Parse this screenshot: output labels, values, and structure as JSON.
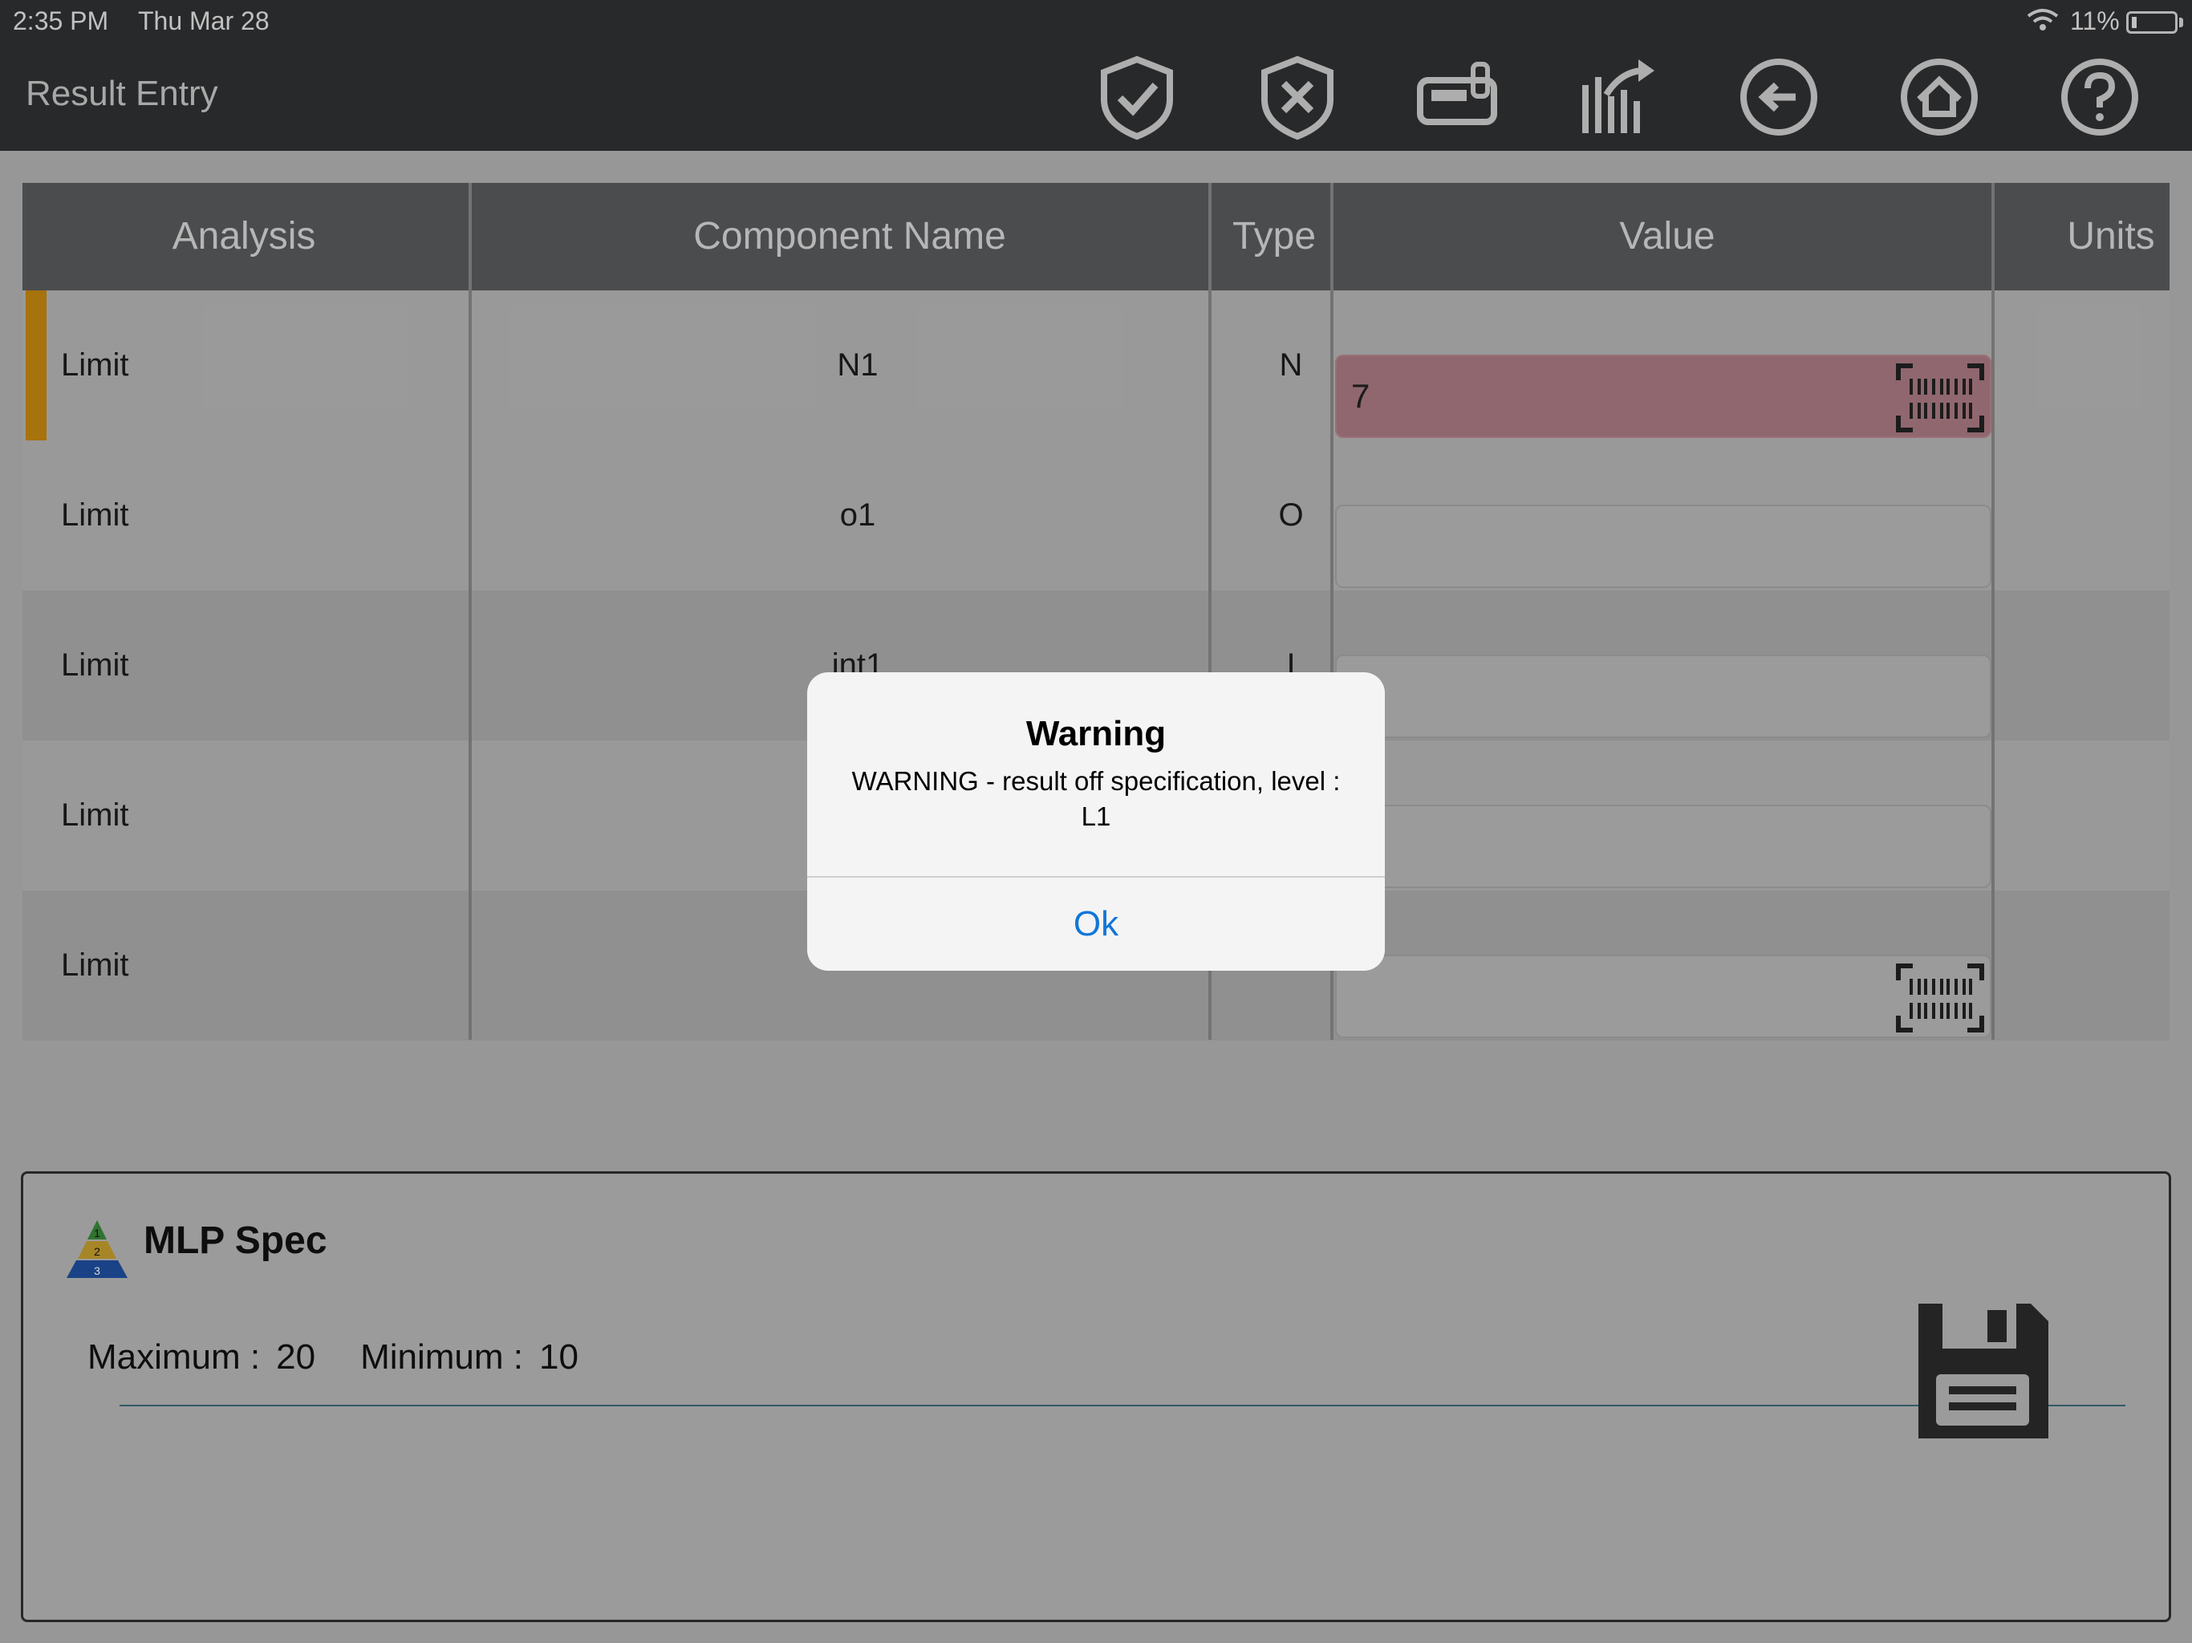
{
  "status": {
    "time": "2:35 PM",
    "date": "Thu Mar 28",
    "battery": "11%"
  },
  "nav": {
    "title": "Result Entry",
    "icons": [
      "shield-check-icon",
      "shield-x-icon",
      "instrument-icon",
      "chart-share-icon",
      "back-arrow-icon",
      "home-icon",
      "help-icon"
    ]
  },
  "table": {
    "headers": {
      "analysis": "Analysis",
      "component": "Component Name",
      "type": "Type",
      "value": "Value",
      "units": "Units"
    },
    "rows": [
      {
        "analysis": "Limit",
        "component": "N1",
        "type": "N",
        "value": "7"
      },
      {
        "analysis": "Limit",
        "component": "o1",
        "type": "O",
        "value": ""
      },
      {
        "analysis": "Limit",
        "component": "int1",
        "type": "I",
        "value": ""
      },
      {
        "analysis": "Limit",
        "component": "",
        "type": "",
        "value": ""
      },
      {
        "analysis": "Limit",
        "component": "",
        "type": "",
        "value": ""
      }
    ]
  },
  "spec": {
    "title": "MLP Spec",
    "max_label": "Maximum :",
    "max_value": "20",
    "min_label": "Minimum :",
    "min_value": "10"
  },
  "dialog": {
    "title": "Warning",
    "message": "WARNING - result off specification, level : L1",
    "ok": "Ok"
  },
  "colors": {
    "error_field": "#ac7b85",
    "accent_marker": "#c88a10",
    "link_blue": "#1276d8"
  }
}
